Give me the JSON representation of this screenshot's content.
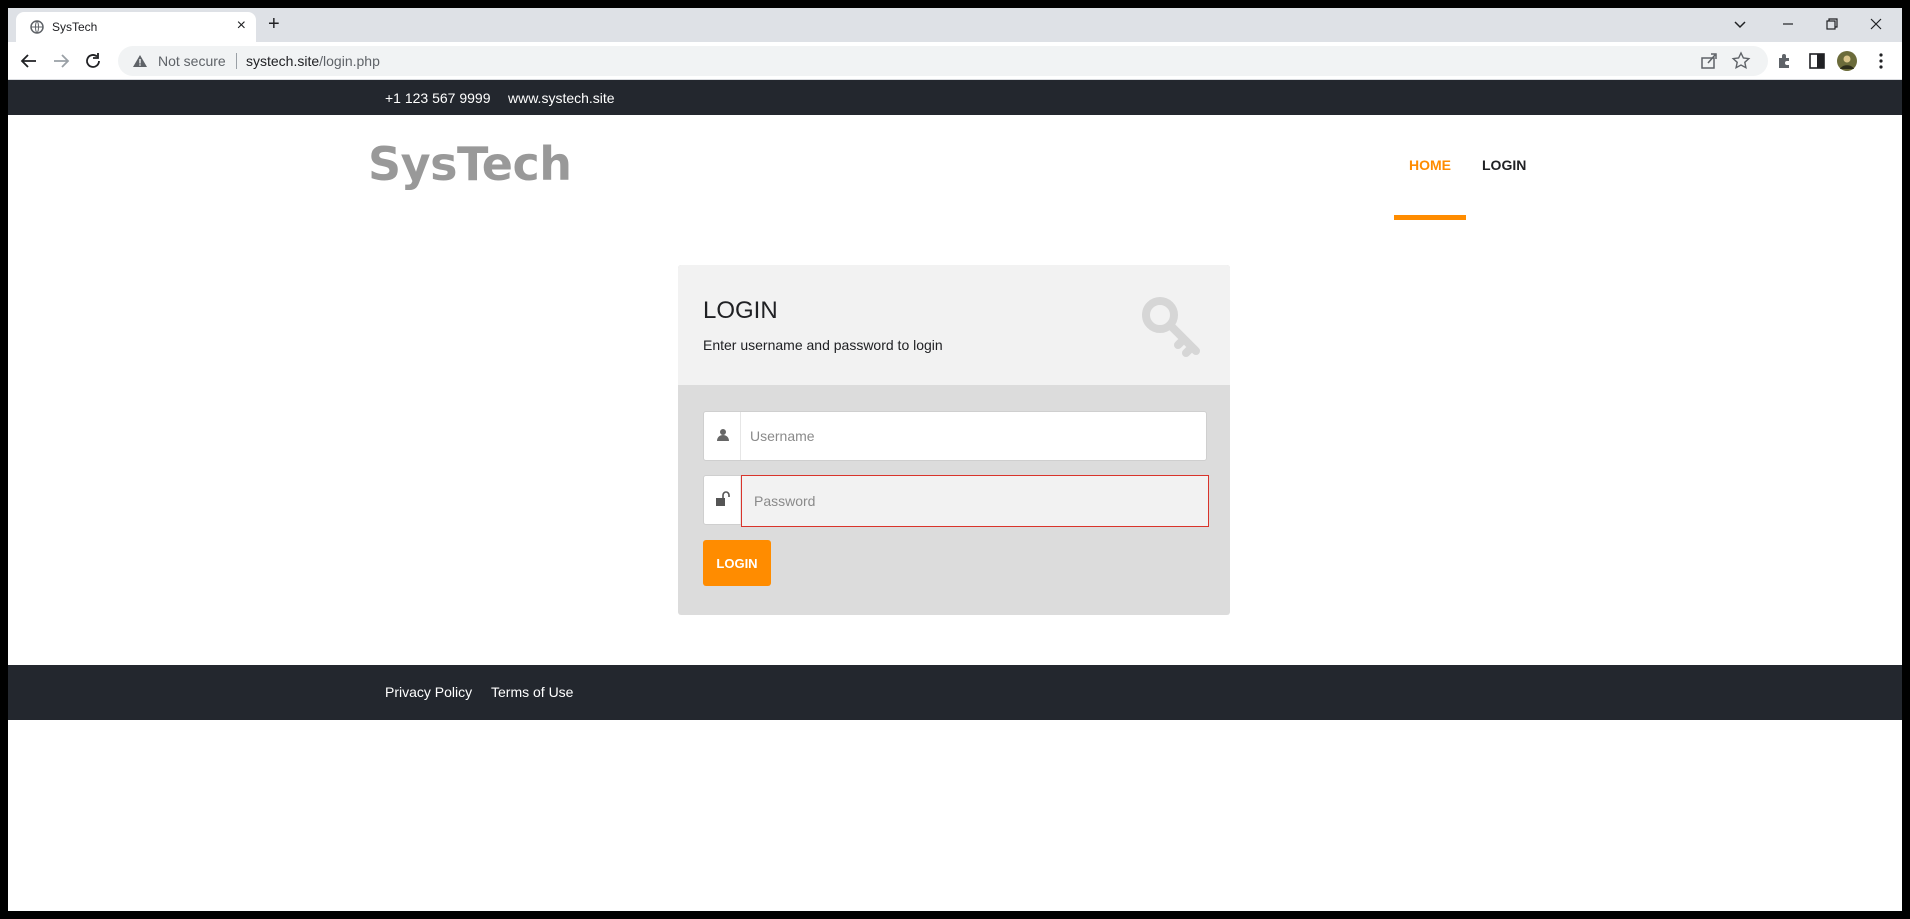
{
  "browser": {
    "tab_title": "SysTech",
    "new_tab_label": "+",
    "security_label": "Not secure",
    "url_host": "systech.site",
    "url_path": "/login.php"
  },
  "site": {
    "phone": "+1 123 567 9999",
    "website": "www.systech.site",
    "logo": "SysTech",
    "nav": {
      "home": "HOME",
      "login": "LOGIN"
    },
    "accent_color": "#ff8c00",
    "dark_color": "#23272e"
  },
  "login_form": {
    "title": "LOGIN",
    "subtitle": "Enter username and password to login",
    "username_placeholder": "Username",
    "password_placeholder": "Password",
    "submit_label": "LOGIN"
  },
  "footer": {
    "privacy": "Privacy Policy",
    "terms": "Terms of Use"
  }
}
